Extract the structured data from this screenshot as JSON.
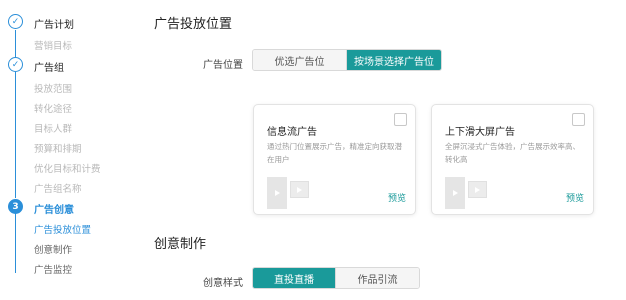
{
  "sidebar": {
    "steps": [
      {
        "title": "广告计划",
        "state": "done",
        "subs": [
          "营销目标"
        ]
      },
      {
        "title": "广告组",
        "state": "done",
        "subs": [
          "投放范围",
          "转化途径",
          "目标人群",
          "预算和排期",
          "优化目标和计费",
          "广告组名称"
        ]
      },
      {
        "number": "3",
        "title": "广告创意",
        "state": "active",
        "subs": [
          "广告投放位置",
          "创意制作",
          "广告监控"
        ]
      }
    ]
  },
  "placement": {
    "section_title": "广告投放位置",
    "label": "广告位置",
    "options": [
      "优选广告位",
      "按场景选择广告位"
    ],
    "selected": "按场景选择广告位"
  },
  "cards": [
    {
      "title": "信息流广告",
      "desc": "通过热门位置展示广告，精准定向获取潜在用户",
      "preview": "预览"
    },
    {
      "title": "上下滑大屏广告",
      "desc": "全屏沉浸式广告体验，广告展示效率高、转化高",
      "preview": "预览"
    }
  ],
  "creative": {
    "section_title": "创意制作",
    "label": "创意样式",
    "options": [
      "直投直播",
      "作品引流"
    ],
    "selected": "直投直播"
  },
  "colors": {
    "primary_blue": "#2b8fd9",
    "teal": "#1a9a9a"
  }
}
